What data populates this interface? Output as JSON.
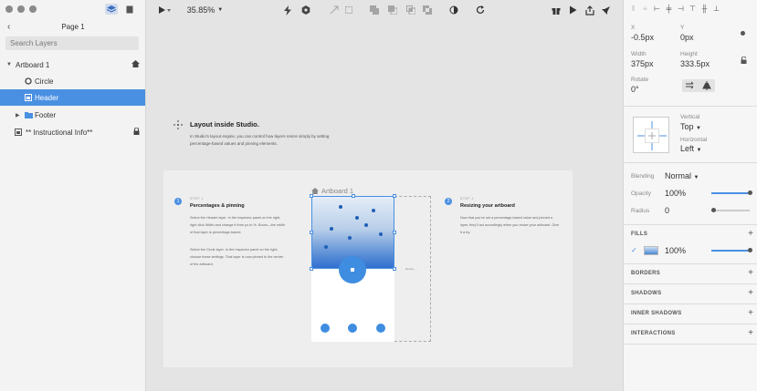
{
  "left_panel": {
    "page_title": "Page 1",
    "search_placeholder": "Search Layers",
    "layers": [
      {
        "label": "Artboard 1"
      },
      {
        "label": "Circle"
      },
      {
        "label": "Header"
      },
      {
        "label": "Footer"
      },
      {
        "label": "** Instructional Info**"
      }
    ]
  },
  "toolbar": {
    "zoom": "35.85%"
  },
  "canvas": {
    "intro_title": "Layout inside Studio.",
    "intro_body": "In Studio's layout engine, you can control how layers resize simply by setting percentage-based values and pinning elements.",
    "step1_label": "STEP 1",
    "step1_title": "Percentages & pinning",
    "step1_body_a": "Select the Header layer. In the Inspector panel on the right, right click Width and change it from px to %. Boom—the width of that layer is percentage-based.",
    "step1_body_b": "Select the Circle layer. In the Inspector panel on the right, choose these settings. That layer is now pinned to the center of the artboard.",
    "step2_label": "STEP 2",
    "step2_title": "Resizing your artboard",
    "step2_body": "Now that you've set a percentage-based value and pinned a layer, they'll act accordingly when you resize your artboard. Give it a try.",
    "artboard_label": "Artboard 1",
    "dash_note": "Resize →"
  },
  "inspector": {
    "x_label": "X",
    "x_value": "-0.5px",
    "y_label": "Y",
    "y_value": "0px",
    "width_label": "Width",
    "width_value": "375px",
    "height_label": "Height",
    "height_value": "333.5px",
    "rotate_label": "Rotate",
    "rotate_value": "0°",
    "vertical_label": "Vertical",
    "vertical_value": "Top",
    "horizontal_label": "Horizontal",
    "horizontal_value": "Left",
    "blending_label": "Blending",
    "blending_value": "Normal",
    "opacity_label": "Opacity",
    "opacity_value": "100%",
    "radius_label": "Radius",
    "radius_value": "0",
    "fills_label": "FILLS",
    "fill_opacity": "100%",
    "borders_label": "BORDERS",
    "shadows_label": "SHADOWS",
    "inner_shadows_label": "INNER SHADOWS",
    "interactions_label": "INTERACTIONS"
  },
  "colors": {
    "accent": "#4a90e2"
  }
}
